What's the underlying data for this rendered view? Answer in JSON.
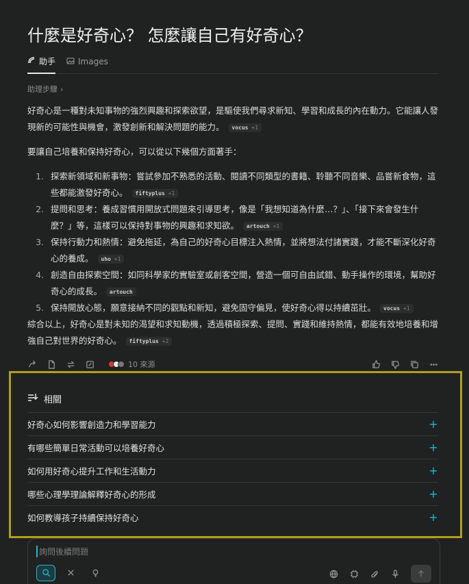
{
  "title": "什麼是好奇心？ 怎麼讓自己有好奇心？",
  "tabs": [
    {
      "label": "助手",
      "icon": "assistant-icon",
      "active": true
    },
    {
      "label": "Images",
      "icon": "image-icon",
      "active": false
    }
  ],
  "steps_label": "助理步驟",
  "answer": {
    "intro": "好奇心是一種對未知事物的強烈興趣和探索欲望，是驅使我們尋求新知、學習和成長的內在動力。它能讓人發現新的可能性與機會，激發創新和解決問題的能力。",
    "intro_cite": {
      "name": "vocus",
      "more": "+1"
    },
    "lead": "要讓自己培養和保持好奇心，可以從以下幾個方面著手：",
    "items": [
      {
        "num": "1.",
        "text": "探索新領域和新事物：嘗試參加不熟悉的活動、閱讀不同類型的書籍、聆聽不同音樂、品嘗新食物，這些都能激發好奇心。",
        "cite": "fiftyplus",
        "more": "+1"
      },
      {
        "num": "2.",
        "text": "提問和思考：養成習慣用開放式問題來引導思考，像是「我想知道為什麼…？」、「接下來會發生什麼？」等，這樣可以保持對事物的興趣和求知欲。",
        "cite": "artouch",
        "more": "+1"
      },
      {
        "num": "3.",
        "text": "保持行動力和熱情：避免拖延，為自己的好奇心目標注入熱情，並將想法付諸實踐，才能不斷深化好奇心的養成。",
        "cite": "uho",
        "more": "+1"
      },
      {
        "num": "4.",
        "text": "創造自由探索空間：如同科學家的實驗室或創客空間，營造一個可自由試錯、動手操作的環境，幫助好奇心的成長。",
        "cite": "artouch",
        "more": ""
      },
      {
        "num": "5.",
        "text": "保持開放心態，願意接納不同的觀點和新知，避免固守偏見，使好奇心得以持續茁壯。",
        "cite": "vocus",
        "more": "+1"
      }
    ],
    "summary": "綜合以上，好奇心是對未知的渴望和求知動機，透過積極探索、提問、實踐和維持熱情，都能有效地培養和增強自己對世界的好奇心。",
    "summary_cite": {
      "name": "fiftyplus",
      "more": "+2"
    }
  },
  "actions": {
    "left_icons": [
      "share-icon",
      "copy-doc-icon",
      "rewrite-icon",
      "export-icon"
    ],
    "sources_label": "10 來源",
    "right_icons": [
      "thumbs-up-icon",
      "thumbs-down-icon",
      "copy-icon",
      "more-icon"
    ]
  },
  "related": {
    "heading": "相關",
    "items": [
      "好奇心如何影響創造力和學習能力",
      "有哪些簡單日常活動可以培養好奇心",
      "如何用好奇心提升工作和生活動力",
      "哪些心理學理論解釋好奇心的形成",
      "如何教導孩子持續保持好奇心"
    ]
  },
  "composer": {
    "placeholder": "詢問後續問題"
  },
  "colors": {
    "background": "#202222",
    "accent": "#20b8cd",
    "highlight": "#b0a11a"
  }
}
